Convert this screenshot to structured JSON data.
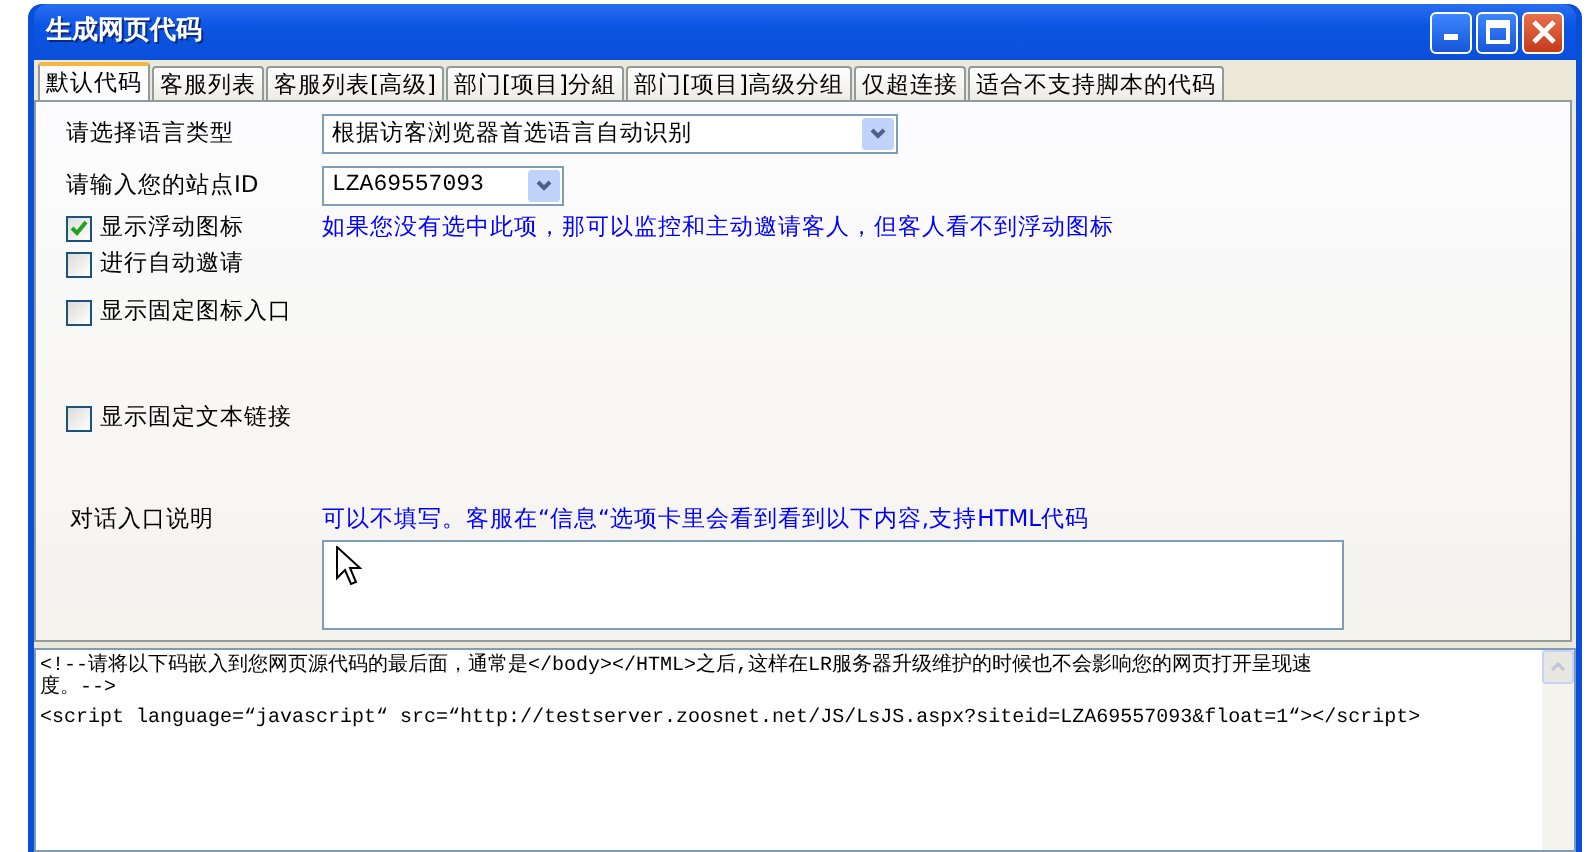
{
  "window": {
    "title": "生成网页代码"
  },
  "tabs": [
    {
      "label": "默认代码",
      "selected": true
    },
    {
      "label": "客服列表",
      "selected": false
    },
    {
      "label": "客服列表[高级]",
      "selected": false
    },
    {
      "label": "部门[项目]分組",
      "selected": false
    },
    {
      "label": "部门[项目]高级分组",
      "selected": false
    },
    {
      "label": "仅超连接",
      "selected": false
    },
    {
      "label": "适合不支持脚本的代码",
      "selected": false
    }
  ],
  "language": {
    "label": "请选择语言类型",
    "value": "根据访客浏览器首选语言自动识别"
  },
  "site_id": {
    "label": "请输入您的站点ID",
    "value": "LZA69557093"
  },
  "options": [
    {
      "label": "显示浮动图标",
      "checked": true,
      "hint": "如果您没有选中此项，那可以监控和主动邀请客人，但客人看不到浮动图标"
    },
    {
      "label": "进行自动邀请",
      "checked": false
    },
    {
      "label": "显示固定图标入口",
      "checked": false
    },
    {
      "label": "显示固定文本链接",
      "checked": false
    }
  ],
  "dialog_note": {
    "label": "对话入口说明",
    "hint": "可以不填写。客服在“信息“选项卡里会看到看到以下内容,支持HTML代码"
  },
  "code_lines": [
    "<!--请将以下码嵌入到您网页源代码的最后面，通常是</body></HTML>之后,这样在LR服务器升级维护的时候也不会影响您的网页打开呈现速",
    "度。-->",
    "<script language=“javascript“ src=“http://testserver.zoosnet.net/JS/LsJS.aspx?siteid=LZA69557093&float=1“></script>"
  ]
}
